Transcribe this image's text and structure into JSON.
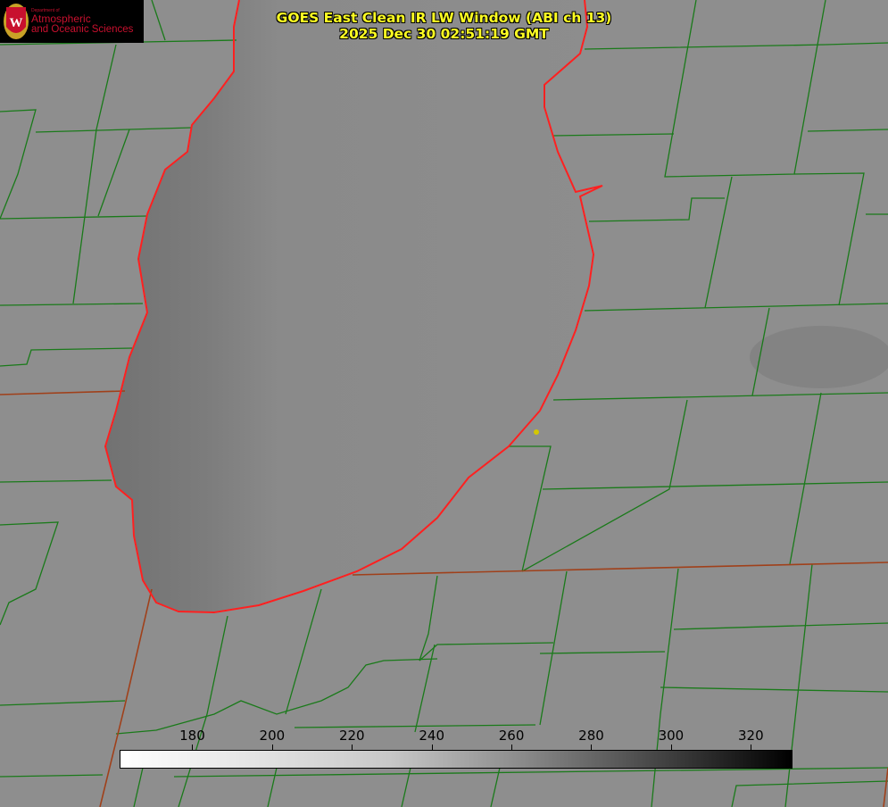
{
  "title": {
    "line1": "GOES East Clean IR LW Window (ABI ch 13)",
    "line2": "2025 Dec 30 02:51:19 GMT"
  },
  "logo": {
    "department": "Department of",
    "line1": "Atmospheric",
    "line2": "and Oceanic Sciences",
    "emblem": "W"
  },
  "colorbar": {
    "ticks": [
      "180",
      "200",
      "220",
      "240",
      "260",
      "280",
      "300",
      "320"
    ],
    "range": [
      162,
      330
    ],
    "colormap": "white-to-black grayscale"
  },
  "colors": {
    "county_lines": "#1a7a1a",
    "coastline": "#ff2020",
    "title": "#ffff22",
    "marker": "#d4c800"
  }
}
